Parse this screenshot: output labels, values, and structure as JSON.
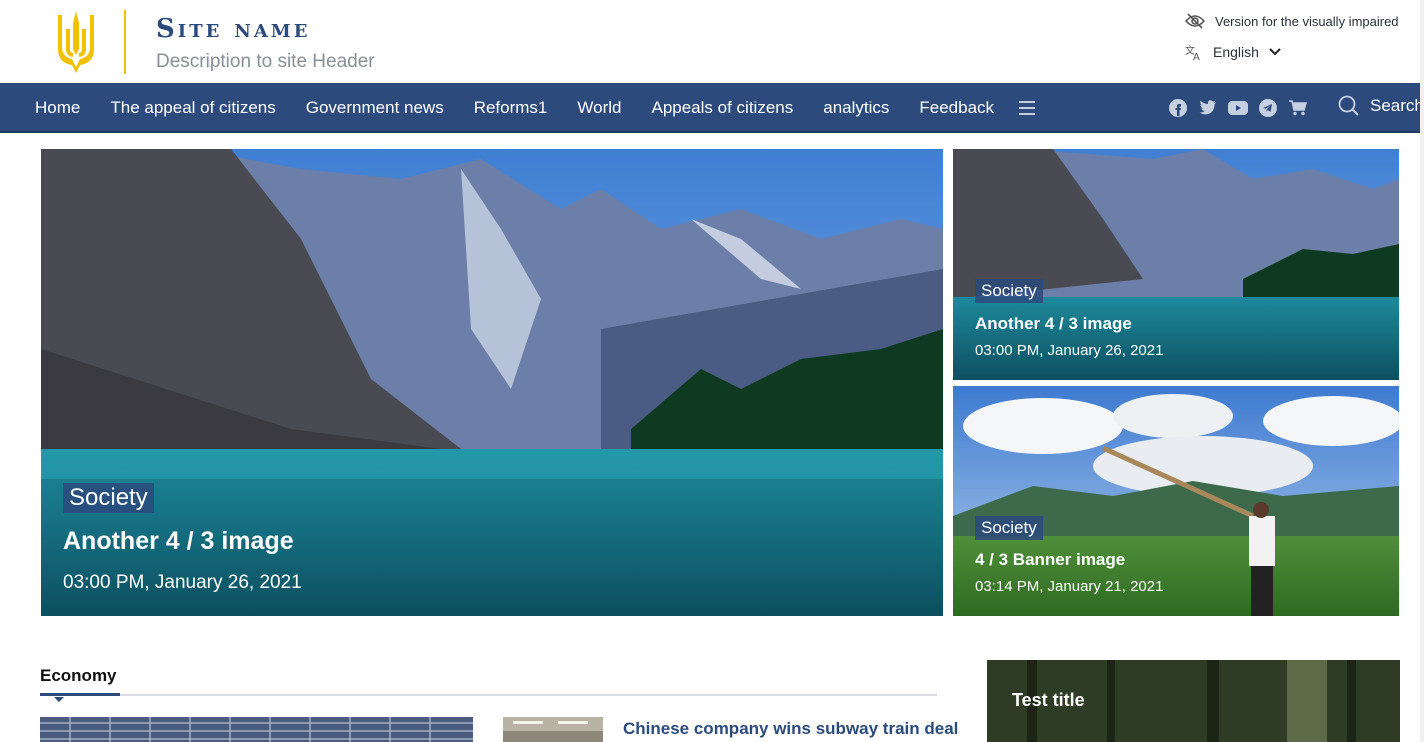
{
  "header": {
    "site_name": "Site name",
    "description": "Description to site Header",
    "visually_impaired": "Version for the visually impaired",
    "language": "English",
    "accent_color": "#2c4a7c",
    "logo_color": "#f2c200"
  },
  "nav": {
    "items": [
      "Home",
      "The appeal of citizens",
      "Government news",
      "Reforms1",
      "World",
      "Appeals of citizens",
      "analytics",
      "Feedback"
    ],
    "social_icons": [
      "facebook-icon",
      "twitter-icon",
      "youtube-icon",
      "telegram-icon",
      "cart-icon"
    ],
    "search_label": "Search"
  },
  "hero": {
    "main": {
      "category": "Society",
      "title": "Another 4 / 3 image",
      "date": "03:00 PM, January 26, 2021"
    },
    "side": [
      {
        "category": "Society",
        "title": "Another 4 / 3 image",
        "date": "03:00 PM, January 26, 2021"
      },
      {
        "category": "Society",
        "title": "4 / 3 Banner image",
        "date": "03:14 PM, January 21, 2021"
      }
    ]
  },
  "economy": {
    "heading": "Economy",
    "news_title": "Chinese company wins subway train deal"
  },
  "sidebar": {
    "card_title": "Test title"
  }
}
